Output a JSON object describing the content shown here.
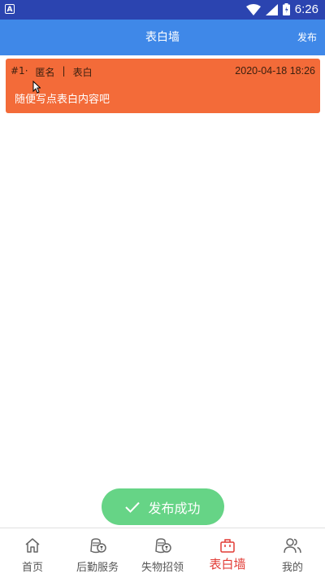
{
  "status_bar": {
    "app_badge": "A",
    "time": "6:26"
  },
  "header": {
    "title": "表白墙",
    "publish_label": "发布"
  },
  "posts": [
    {
      "number": "#1·",
      "author": "匿名",
      "separator": "|",
      "category": "表白",
      "date": "2020-04-18 18:26",
      "content": "随便写点表白内容吧"
    }
  ],
  "toast": {
    "text": "发布成功"
  },
  "tabbar": {
    "items": [
      {
        "label": "首页",
        "icon": "home-icon",
        "active": false
      },
      {
        "label": "后勤服务",
        "icon": "coin-bag-icon",
        "active": false
      },
      {
        "label": "失物招领",
        "icon": "coin-bag-icon",
        "active": false
      },
      {
        "label": "表白墙",
        "icon": "bag-icon",
        "active": true
      },
      {
        "label": "我的",
        "icon": "user-icon",
        "active": false
      }
    ]
  },
  "colors": {
    "header": "#3f88e8",
    "status_bar": "#2b44b0",
    "card": "#f36b39",
    "toast": "#66d486",
    "active_tab": "#e23b35"
  }
}
